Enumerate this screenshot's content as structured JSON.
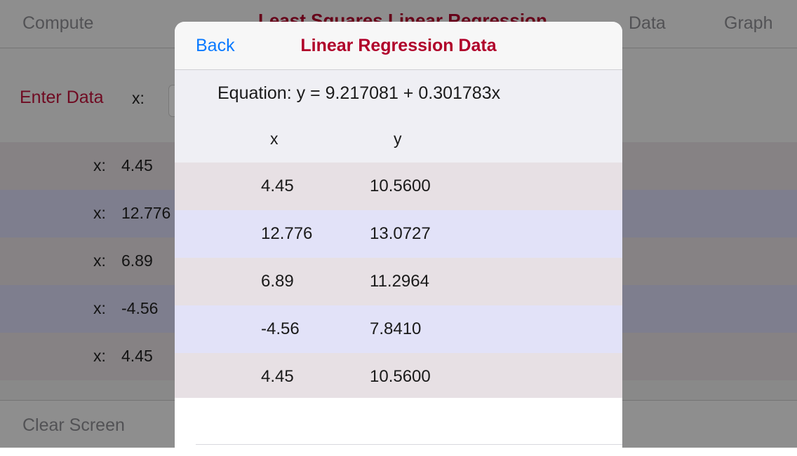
{
  "app": {
    "nav": {
      "compute_label": "Compute",
      "title": "Least Squares Linear Regression",
      "data_label": "Data",
      "graph_label": "Graph"
    },
    "entry": {
      "enter_data_label": "Enter Data",
      "x_label": "x:"
    },
    "rows": [
      {
        "label": "x:",
        "value": "4.45"
      },
      {
        "label": "x:",
        "value": "12.776"
      },
      {
        "label": "x:",
        "value": "6.89"
      },
      {
        "label": "x:",
        "value": "-4.56"
      },
      {
        "label": "x:",
        "value": "4.45"
      }
    ],
    "bottom": {
      "clear_label": "Clear Screen"
    }
  },
  "modal": {
    "back_label": "Back",
    "title": "Linear Regression Data",
    "equation": "Equation: y = 9.217081 + 0.301783x",
    "columns": {
      "x": "x",
      "y": "y"
    },
    "rows": [
      {
        "x": "4.45",
        "y": "10.5600"
      },
      {
        "x": "12.776",
        "y": "13.0727"
      },
      {
        "x": "6.89",
        "y": "11.2964"
      },
      {
        "x": "-4.56",
        "y": "7.8410"
      },
      {
        "x": "4.45",
        "y": "10.5600"
      }
    ]
  },
  "colors": {
    "accent_red": "#b0002a",
    "link_blue": "#0a7aff",
    "row_odd": "#e7e0e4",
    "row_even": "#e2e2f8"
  }
}
